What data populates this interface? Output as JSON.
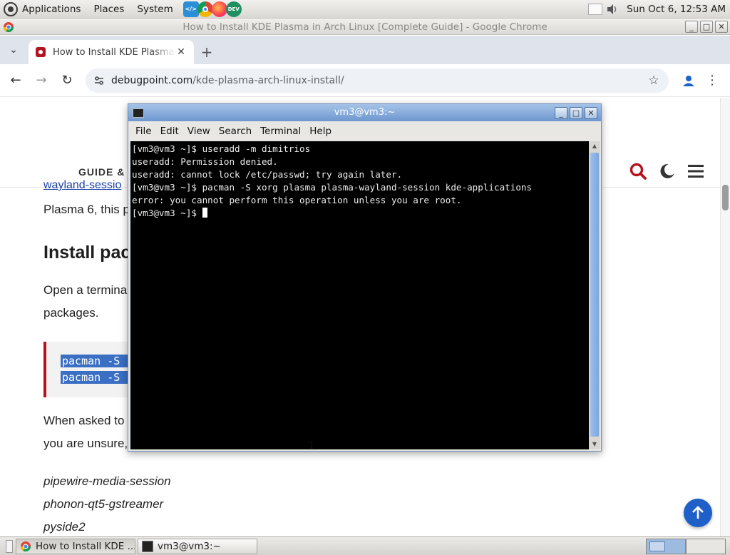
{
  "top_panel": {
    "applications_label": "Applications",
    "places_label": "Places",
    "system_label": "System",
    "launchers": [
      "vscode-icon",
      "chrome-icon",
      "firefox-icon",
      "dev-icon"
    ],
    "clock": "Sun Oct  6, 12:53 AM"
  },
  "chrome": {
    "window_title": "How to Install KDE Plasma in Arch Linux [Complete Guide] - Google Chrome",
    "tab_title": "How to Install KDE Plasma in Arch Linux",
    "new_tab_label": "+",
    "url_host": "debugpoint.com",
    "url_path": "/kde-plasma-arch-linux-install/"
  },
  "page": {
    "nav_label": "GUIDE &",
    "partial_link": "wayland-sessio",
    "para_1": "Plasma 6, this p",
    "heading": "Install pac",
    "para_2a": "Open a termina",
    "para_2b": "packages.",
    "code_lines": [
      "pacman -S -",
      "pacman -S -"
    ],
    "para_3a": "When asked to",
    "para_3b": "you are unsure,",
    "items": [
      "pipewire-media-session",
      "phonon-qt5-gstreamer",
      "pyside2"
    ],
    "accent_color": "#b3131e"
  },
  "terminal": {
    "title": "vm3@vm3:~",
    "menu": [
      "File",
      "Edit",
      "View",
      "Search",
      "Terminal",
      "Help"
    ],
    "lines": [
      "[vm3@vm3 ~]$ useradd -m dimitrios",
      "useradd: Permission denied.",
      "useradd: cannot lock /etc/passwd; try again later.",
      "[vm3@vm3 ~]$ pacman -S xorg plasma plasma-wayland-session kde-applications",
      "error: you cannot perform this operation unless you are root."
    ],
    "prompt": "[vm3@vm3 ~]$ "
  },
  "taskbar": {
    "tasks": [
      {
        "label": "How to Install KDE ...",
        "icon": "chrome-icon"
      },
      {
        "label": "vm3@vm3:~",
        "icon": "terminal-icon"
      }
    ]
  }
}
